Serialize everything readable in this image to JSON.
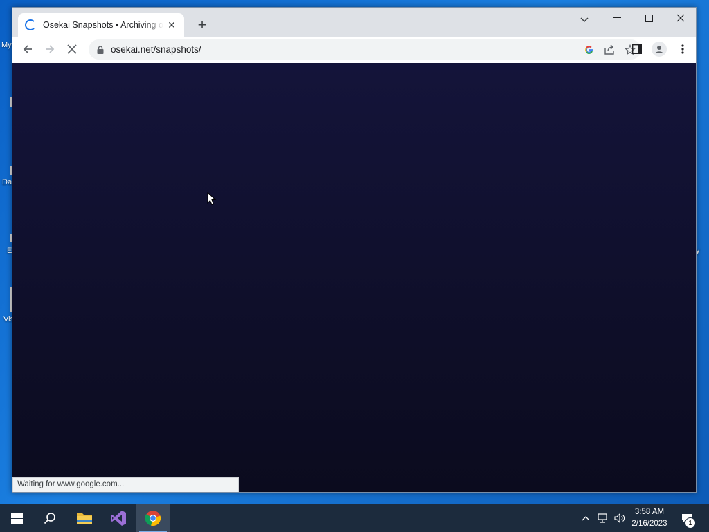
{
  "desktop": {
    "fragments": [
      "My",
      "Da",
      "E",
      "Vis",
      "y"
    ]
  },
  "browser": {
    "tab": {
      "title": "Osekai Snapshots • Archiving osu! history",
      "loading": true
    },
    "address_bar": {
      "url": "osekai.net/snapshots/"
    },
    "page": {
      "background_top": "#14143a",
      "background_bottom": "#0b0b1e"
    },
    "status_text": "Waiting for www.google.com..."
  },
  "taskbar": {
    "apps": [
      "start",
      "search",
      "file-explorer",
      "visual-studio",
      "chrome"
    ],
    "active_app": "chrome",
    "clock": {
      "time": "3:58 AM",
      "date": "2/16/2023"
    },
    "notification_count": "1"
  },
  "colors": {
    "taskbar": "#1c2b3d",
    "accent": "#1a73e8"
  }
}
